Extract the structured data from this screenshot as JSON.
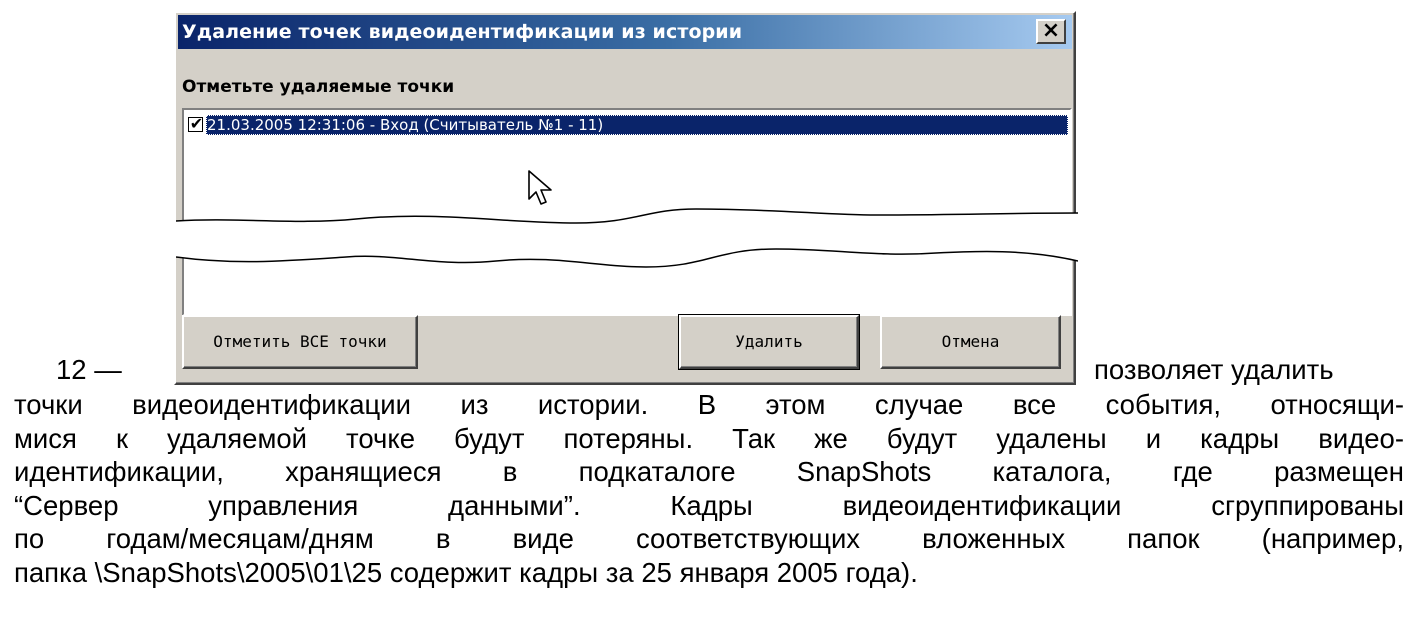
{
  "dialog": {
    "title": "Удаление точек видеоидентификации из истории",
    "close_label": "×",
    "section_label": "Отметьте удаляемые точки",
    "items": [
      {
        "checked": true,
        "label": "21.03.2005  12:31:06 - Вход (Считыватель №1 - 11)"
      }
    ],
    "buttons": {
      "mark_all": "Отметить ВСЕ точки",
      "delete": "Удалить",
      "cancel": "Отмена"
    }
  },
  "document": {
    "number_prefix": "12 —",
    "inline_text": "позволяет удалить",
    "lines": [
      "точки видеоидентификации из истории. В этом случае все события, относящи-",
      "мися к удаляемой точке будут потеряны. Так же будут удалены и кадры видео-",
      "идентификации, хранящиеся в подкаталоге SnapShots каталога, где размещен",
      "“Сервер управления данными”. Кадры видеоидентификации сгруппированы",
      "по годам/месяцам/дням в виде соответствующих вложенных папок (например,",
      "папка \\SnapShots\\2005\\01\\25 содержит кадры за 25 января 2005 года)."
    ]
  },
  "colors": {
    "title_active": "#0a246a",
    "face": "#d4d0c8",
    "selection": "#0a246a"
  },
  "icons": {
    "cursor": "mouse-pointer-icon",
    "check": "checkmark-icon",
    "close": "close-icon"
  }
}
